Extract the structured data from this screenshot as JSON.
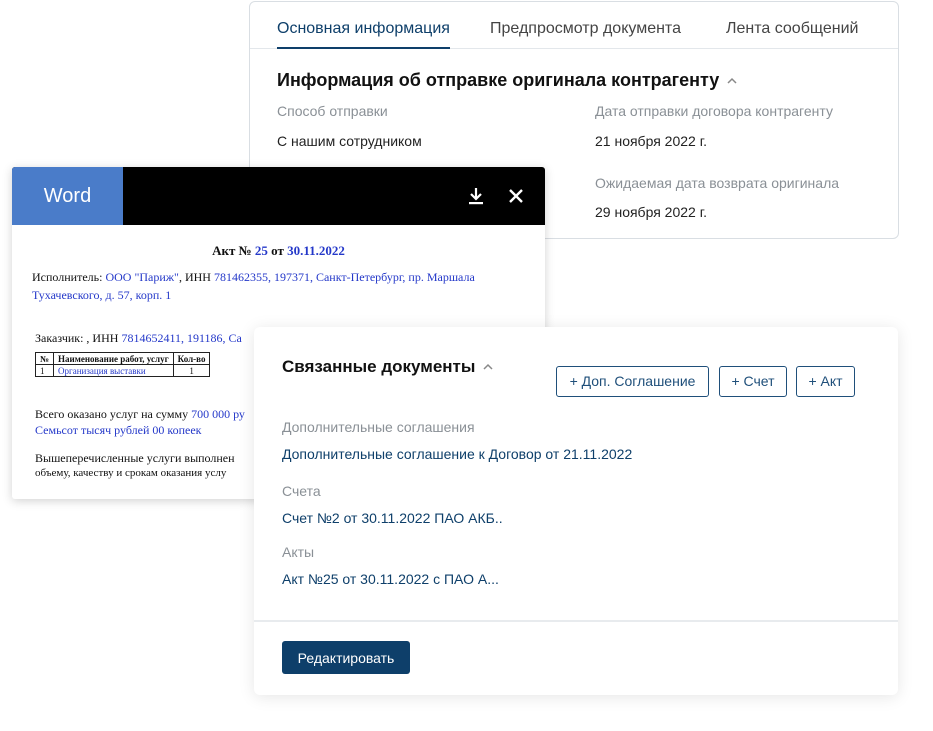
{
  "info_card": {
    "tabs": [
      {
        "label": "Основная информация"
      },
      {
        "label": "Предпросмотр документа"
      },
      {
        "label": "Лента сообщений"
      }
    ],
    "section_title": "Информация об отправке оригинала контрагенту",
    "fields": {
      "send_method_label": "Способ отправки",
      "send_method_value": "С нашим сотрудником",
      "send_date_label": "Дата отправки договора контрагенту",
      "send_date_value": "21 ноября  2022 г.",
      "return_date_label": "Ожидаемая дата возврата оригинала",
      "return_date_value": "29 ноября  2022 г."
    }
  },
  "word_viewer": {
    "badge": "Word",
    "document": {
      "title_prefix": "Акт №",
      "title_number": "25",
      "title_mid": "от",
      "title_date": "30.11.2022",
      "executor_prefix": "Исполнитель:",
      "executor_name": "ООО \"Париж\"",
      "executor_inn_label": ", ИНН",
      "executor_details": "781462355, 197371, Санкт-Петербург, пр. Маршала",
      "executor_details_2": "Тухачевского, д. 57, корп. 1",
      "customer_prefix": "Заказчик: , ИНН",
      "customer_details": "7814652411, 191186, Са",
      "table_headers": [
        "№",
        "Наименование работ, услуг",
        "Кол-во"
      ],
      "table_row": [
        "1",
        "Организация выставки",
        "1"
      ],
      "total_prefix": "Всего оказано услуг на сумму",
      "total_amount": "700 000 ру",
      "total_words": "Семьсот тысяч рублей 00 копеек",
      "conclusion_1": "Вышеперечисленные  услуги  выполнен",
      "conclusion_2": "объему, качеству и срокам оказания услу"
    }
  },
  "linked_card": {
    "title": "Связанные документы",
    "buttons": {
      "add_agreement": "+ Доп. Соглашение",
      "add_invoice": "+ Счет",
      "add_act": "+ Акт"
    },
    "groups": [
      {
        "label": "Дополнительные соглашения",
        "link": "Дополнительные соглашение к Договор от 21.11.2022"
      },
      {
        "label": "Счета",
        "link": "Счет №2 от 30.11.2022 ПАО АКБ.."
      },
      {
        "label": "Акты",
        "link": "Акт №25 от 30.11.2022 с ПАО А..."
      }
    ],
    "edit_button": "Редактировать"
  },
  "colors": {
    "accent": "#0e3f6a",
    "word_badge": "#4a7cc9",
    "doc_link": "#2438c9"
  }
}
